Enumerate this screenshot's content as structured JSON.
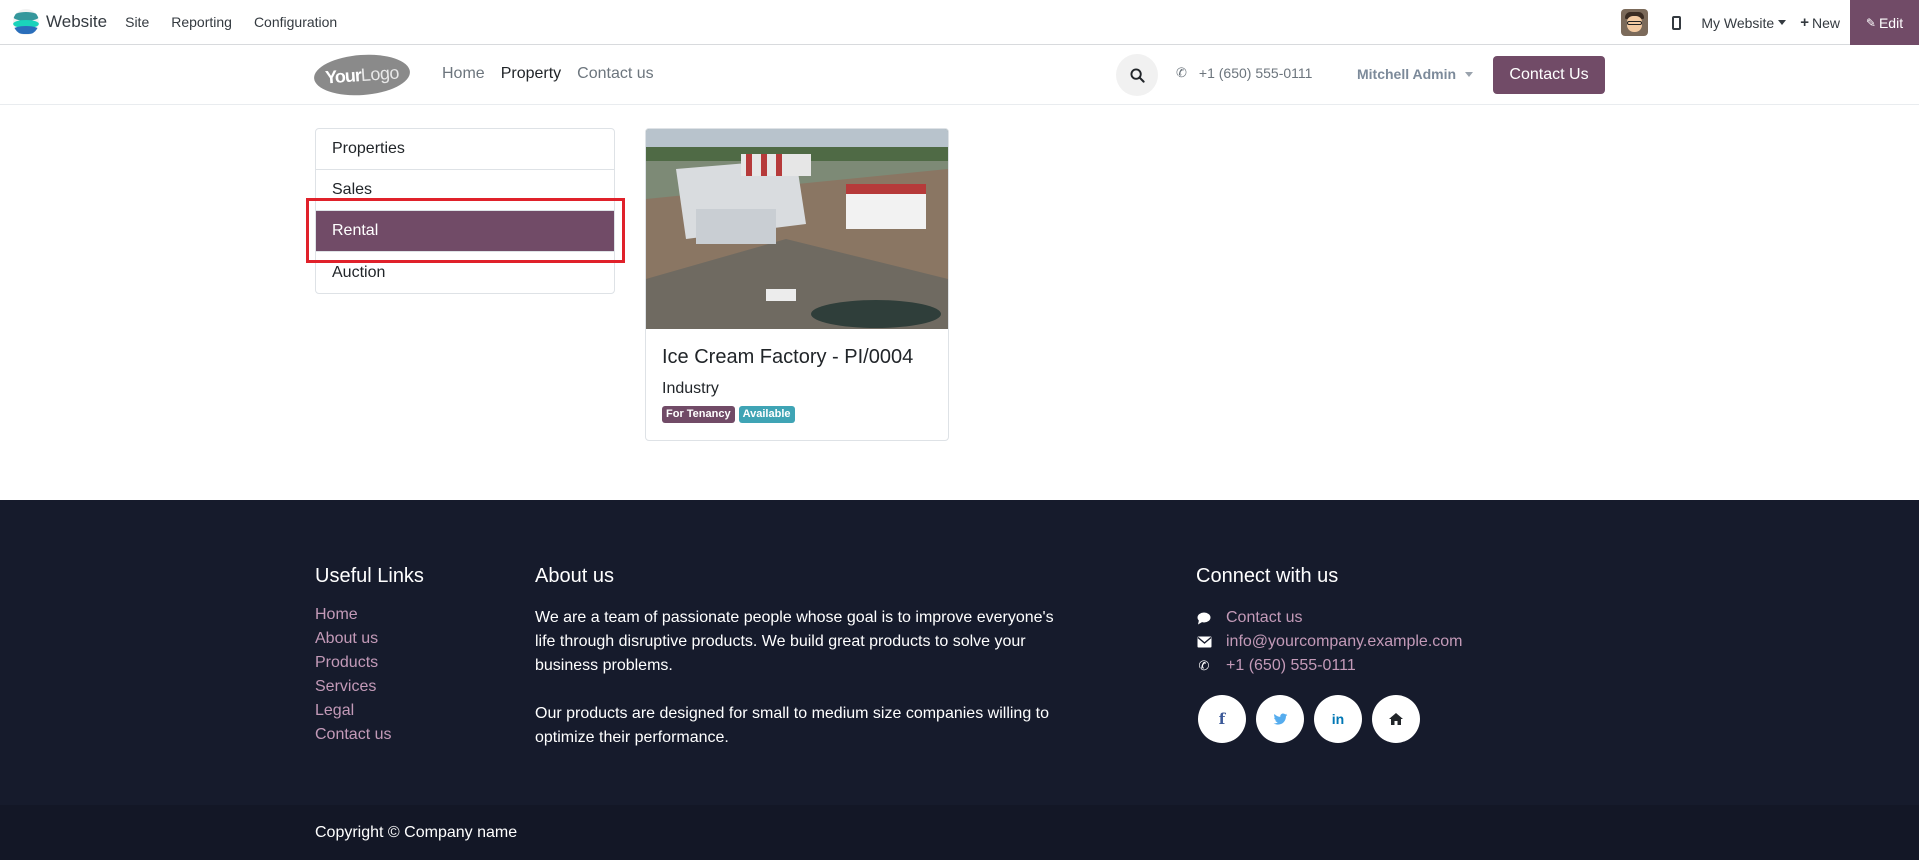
{
  "adminbar": {
    "app_title": "Website",
    "menu": [
      "Site",
      "Reporting",
      "Configuration"
    ],
    "site_selector": "My Website",
    "new_label": "New",
    "edit_label": "Edit"
  },
  "header": {
    "logo_your": "Your",
    "logo_logo": "Logo",
    "nav": [
      "Home",
      "Property",
      "Contact us"
    ],
    "active_nav": "Property",
    "phone": "+1 (650) 555-0111",
    "user": "Mitchell Admin",
    "cta": "Contact Us"
  },
  "categories": {
    "items": [
      "Properties",
      "Sales",
      "Rental",
      "Auction"
    ],
    "active": "Rental"
  },
  "property": {
    "title": "Ice Cream Factory - PI/0004",
    "type": "Industry",
    "badges": [
      "For Tenancy",
      "Available"
    ]
  },
  "footer": {
    "useful_links_title": "Useful Links",
    "useful_links": [
      "Home",
      "About us",
      "Products",
      "Services",
      "Legal",
      "Contact us"
    ],
    "about_title": "About us",
    "about_p1": "We are a team of passionate people whose goal is to improve everyone's life through disruptive products. We build great products to solve your business problems.",
    "about_p2": "Our products are designed for small to medium size companies willing to optimize their performance.",
    "connect_title": "Connect with us",
    "connect_contact": "Contact us",
    "connect_email": "info@yourcompany.example.com",
    "connect_phone": "+1 (650) 555-0111",
    "social": [
      "facebook-icon",
      "twitter-icon",
      "linkedin-icon",
      "home-icon"
    ],
    "copyright": "Copyright © Company name"
  },
  "colors": {
    "brand": "#714b67",
    "footer_bg": "#161b2c",
    "footer_link": "#c39ab8",
    "available_badge": "#3fa4b5",
    "highlight_box": "#e0212a"
  }
}
